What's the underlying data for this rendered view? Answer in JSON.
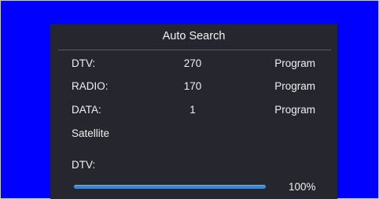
{
  "dialog": {
    "title": "Auto Search",
    "rows": [
      {
        "label": "DTV:",
        "count": "270",
        "unit": "Program"
      },
      {
        "label": "RADIO:",
        "count": "170",
        "unit": "Program"
      },
      {
        "label": "DATA:",
        "count": "1",
        "unit": "Program"
      }
    ],
    "source": "Satellite",
    "current_channel_label": "DTV:",
    "progress": {
      "value_percent": 100,
      "text": "100%"
    }
  },
  "colors": {
    "background": "#0000ff",
    "dialog": "#26262e",
    "progress_fill": "#3f88cf"
  }
}
